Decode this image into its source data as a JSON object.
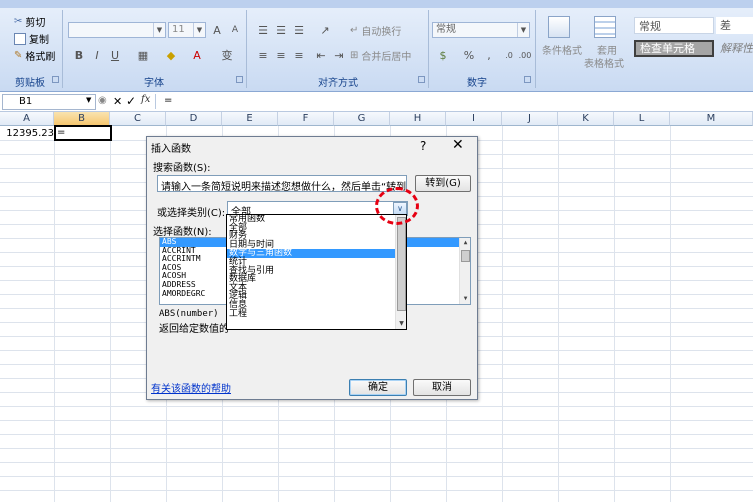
{
  "ribbon": {
    "clipboard": {
      "cut": "剪切",
      "copy": "复制",
      "format_painter": "格式刷",
      "group_label": "剪贴板"
    },
    "font": {
      "font_size": "11",
      "bold": "B",
      "italic": "I",
      "underline": "U",
      "font_color": "A",
      "change_case": "变",
      "group_label": "字体"
    },
    "alignment": {
      "wrap_text": "自动换行",
      "merge_center": "合并后居中",
      "group_label": "对齐方式"
    },
    "number": {
      "format": "常规",
      "percent": "%",
      "comma": ",",
      "group_label": "数字"
    },
    "styles": {
      "conditional_format": "条件格式",
      "table_format_line1": "套用",
      "table_format_line2": "表格格式",
      "normal": "常规",
      "bad": "差",
      "check_cell": "检查单元格",
      "explanatory": "解释性"
    }
  },
  "formula_bar": {
    "name_box": "B1",
    "cancel": "✕",
    "enter": "✓",
    "fx": "fx",
    "value": "="
  },
  "columns": [
    "A",
    "B",
    "C",
    "D",
    "E",
    "F",
    "G",
    "H",
    "I",
    "J",
    "K",
    "L",
    "M"
  ],
  "cells": {
    "A1": "12395.23",
    "B1": "="
  },
  "dialog": {
    "title": "插入函数",
    "help": "?",
    "close": "✕",
    "search_label": "搜索函数(S):",
    "search_text": "请输入一条简短说明来描述您想做什么，然后单击“转到”",
    "goto_button": "转到(G)",
    "category_label": "或选择类别(C):",
    "category_value": "全部",
    "select_label": "选择函数(N):",
    "functions": [
      "ABS",
      "ACCRINT",
      "ACCRINTM",
      "ACOS",
      "ACOSH",
      "ADDRESS",
      "AMORDEGRC"
    ],
    "selected_function": "ABS",
    "signature": "ABS(number)",
    "description": "返回给定数值的",
    "help_link": "有关该函数的帮助",
    "ok_button": "确定",
    "cancel_button": "取消",
    "category_options": [
      "常用函数",
      "全部",
      "财务",
      "日期与时间",
      "数学与三角函数",
      "统计",
      "查找与引用",
      "数据库",
      "文本",
      "逻辑",
      "信息",
      "工程"
    ],
    "category_highlighted": "数学与三角函数"
  },
  "colors": {
    "accent": "#3399ff",
    "annotation": "#e60012",
    "ribbon": "#c9daf2"
  }
}
